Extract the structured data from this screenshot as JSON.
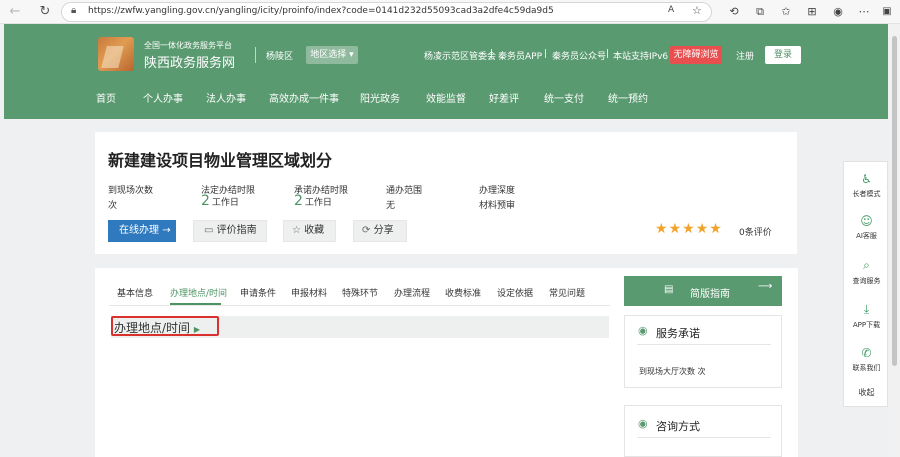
{
  "browser": {
    "url": "https://zwfw.yangling.gov.cn/yangling/icity/proinfo/index?code=0141d232d55093cad3a2dfe4c59da9d5",
    "icons": [
      "back-icon",
      "forward-icon",
      "reload-icon",
      "home-icon",
      "lock-icon",
      "read-aloud-icon",
      "favorite-icon",
      "extensions-icon",
      "split-screen-icon",
      "favorites-bar-icon",
      "collections-icon",
      "profile-icon",
      "sidebar-icon"
    ],
    "read_aloud": "A",
    "sidebar_label": "□"
  },
  "header": {
    "platform_subtitle": "全国一体化政务服务平台",
    "platform_title": "陕西政务服务网",
    "region": "杨陵区",
    "region_select": "地区选择",
    "links": [
      "杨凌示范区管委会",
      "秦务员APP",
      "秦务员公众号",
      "本站支持IPv6"
    ],
    "accessible": "无障碍浏览",
    "register": "注册",
    "login": "登录",
    "nav": [
      "首页",
      "个人办事",
      "法人办事",
      "高效办成一件事",
      "阳光政务",
      "效能监督",
      "好差评",
      "统一支付",
      "统一预约"
    ]
  },
  "item": {
    "title": "新建建设项目物业管理区域划分",
    "stats": [
      {
        "label": "到现场次数",
        "value": "次",
        "big": ""
      },
      {
        "label": "法定办结时限",
        "value": "工作日",
        "big": "2"
      },
      {
        "label": "承诺办结时限",
        "value": "工作日",
        "big": "2"
      },
      {
        "label": "通办范围",
        "value": "无",
        "big": ""
      },
      {
        "label": "办理深度",
        "value": "材料预审",
        "big": ""
      }
    ],
    "online_button": "在线办理",
    "guide_button": "评价指南",
    "favorite_button": "收藏",
    "share_button": "分享",
    "rating": 5,
    "review_count": "0条评价"
  },
  "tabs": [
    "基本信息",
    "办理地点/时间",
    "申请条件",
    "申报材料",
    "特殊环节",
    "办理流程",
    "收费标准",
    "设定依据",
    "常见问题"
  ],
  "active_tab": 1,
  "section": {
    "title": "办理地点/时间"
  },
  "side": {
    "simple_guide": "简版指南",
    "promise_title": "服务承诺",
    "promise_text": "到现场大厅次数",
    "promise_value": "次",
    "consult_title": "咨询方式"
  },
  "float": {
    "items": [
      {
        "label": "长者模式",
        "icon": "elder-mode-icon"
      },
      {
        "label": "AI客服",
        "icon": "ai-service-icon"
      },
      {
        "label": "查询服务",
        "icon": "search-icon"
      },
      {
        "label": "APP下载",
        "icon": "download-icon"
      },
      {
        "label": "联系我们",
        "icon": "phone-icon"
      }
    ],
    "collapse": "收起"
  },
  "colors": {
    "header": "#5a9a70",
    "accent": "#4d9364",
    "primary_button": "#2f7abf",
    "alert": "#e94f4f",
    "star": "#f0a42b"
  }
}
